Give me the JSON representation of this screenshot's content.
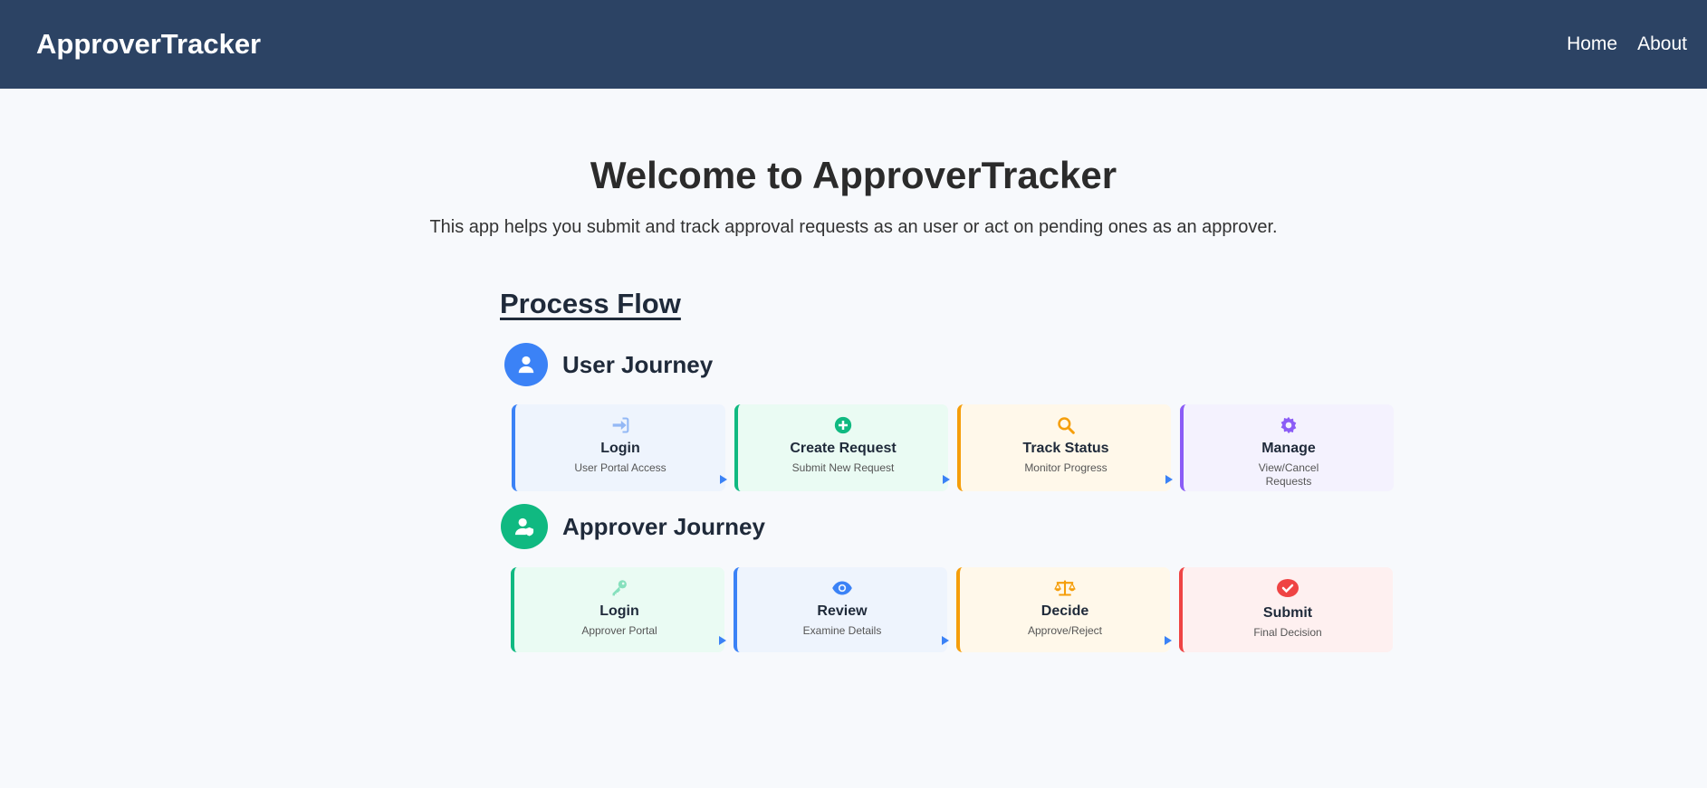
{
  "nav": {
    "brand": "ApproverTracker",
    "links": [
      "Home",
      "About"
    ]
  },
  "hero": {
    "title": "Welcome to ApproverTracker",
    "subtitle": "This app helps you submit and track approval requests as an user or act on pending ones as an approver."
  },
  "flow": {
    "title": "Process Flow",
    "user": {
      "title": "User Journey",
      "steps": [
        {
          "title": "Login",
          "sub": "User Portal Access",
          "icon": "sign-in-icon",
          "color": "#3b82f6"
        },
        {
          "title": "Create Request",
          "sub": "Submit New Request",
          "icon": "plus-circle-icon",
          "color": "#10b981"
        },
        {
          "title": "Track Status",
          "sub": "Monitor Progress",
          "icon": "search-icon",
          "color": "#f59e0b"
        },
        {
          "title": "Manage",
          "sub": "View/Cancel\nRequests",
          "icon": "gear-icon",
          "color": "#8b5cf6"
        }
      ]
    },
    "approver": {
      "title": "Approver Journey",
      "steps": [
        {
          "title": "Login",
          "sub": "Approver Portal",
          "icon": "key-icon",
          "color": "#10b981"
        },
        {
          "title": "Review",
          "sub": "Examine Details",
          "icon": "eye-icon",
          "color": "#3b82f6"
        },
        {
          "title": "Decide",
          "sub": "Approve/Reject",
          "icon": "balance-scale-icon",
          "color": "#f59e0b"
        },
        {
          "title": "Submit",
          "sub": "Final Decision",
          "icon": "check-circle-icon",
          "color": "#ef4444"
        }
      ]
    }
  }
}
